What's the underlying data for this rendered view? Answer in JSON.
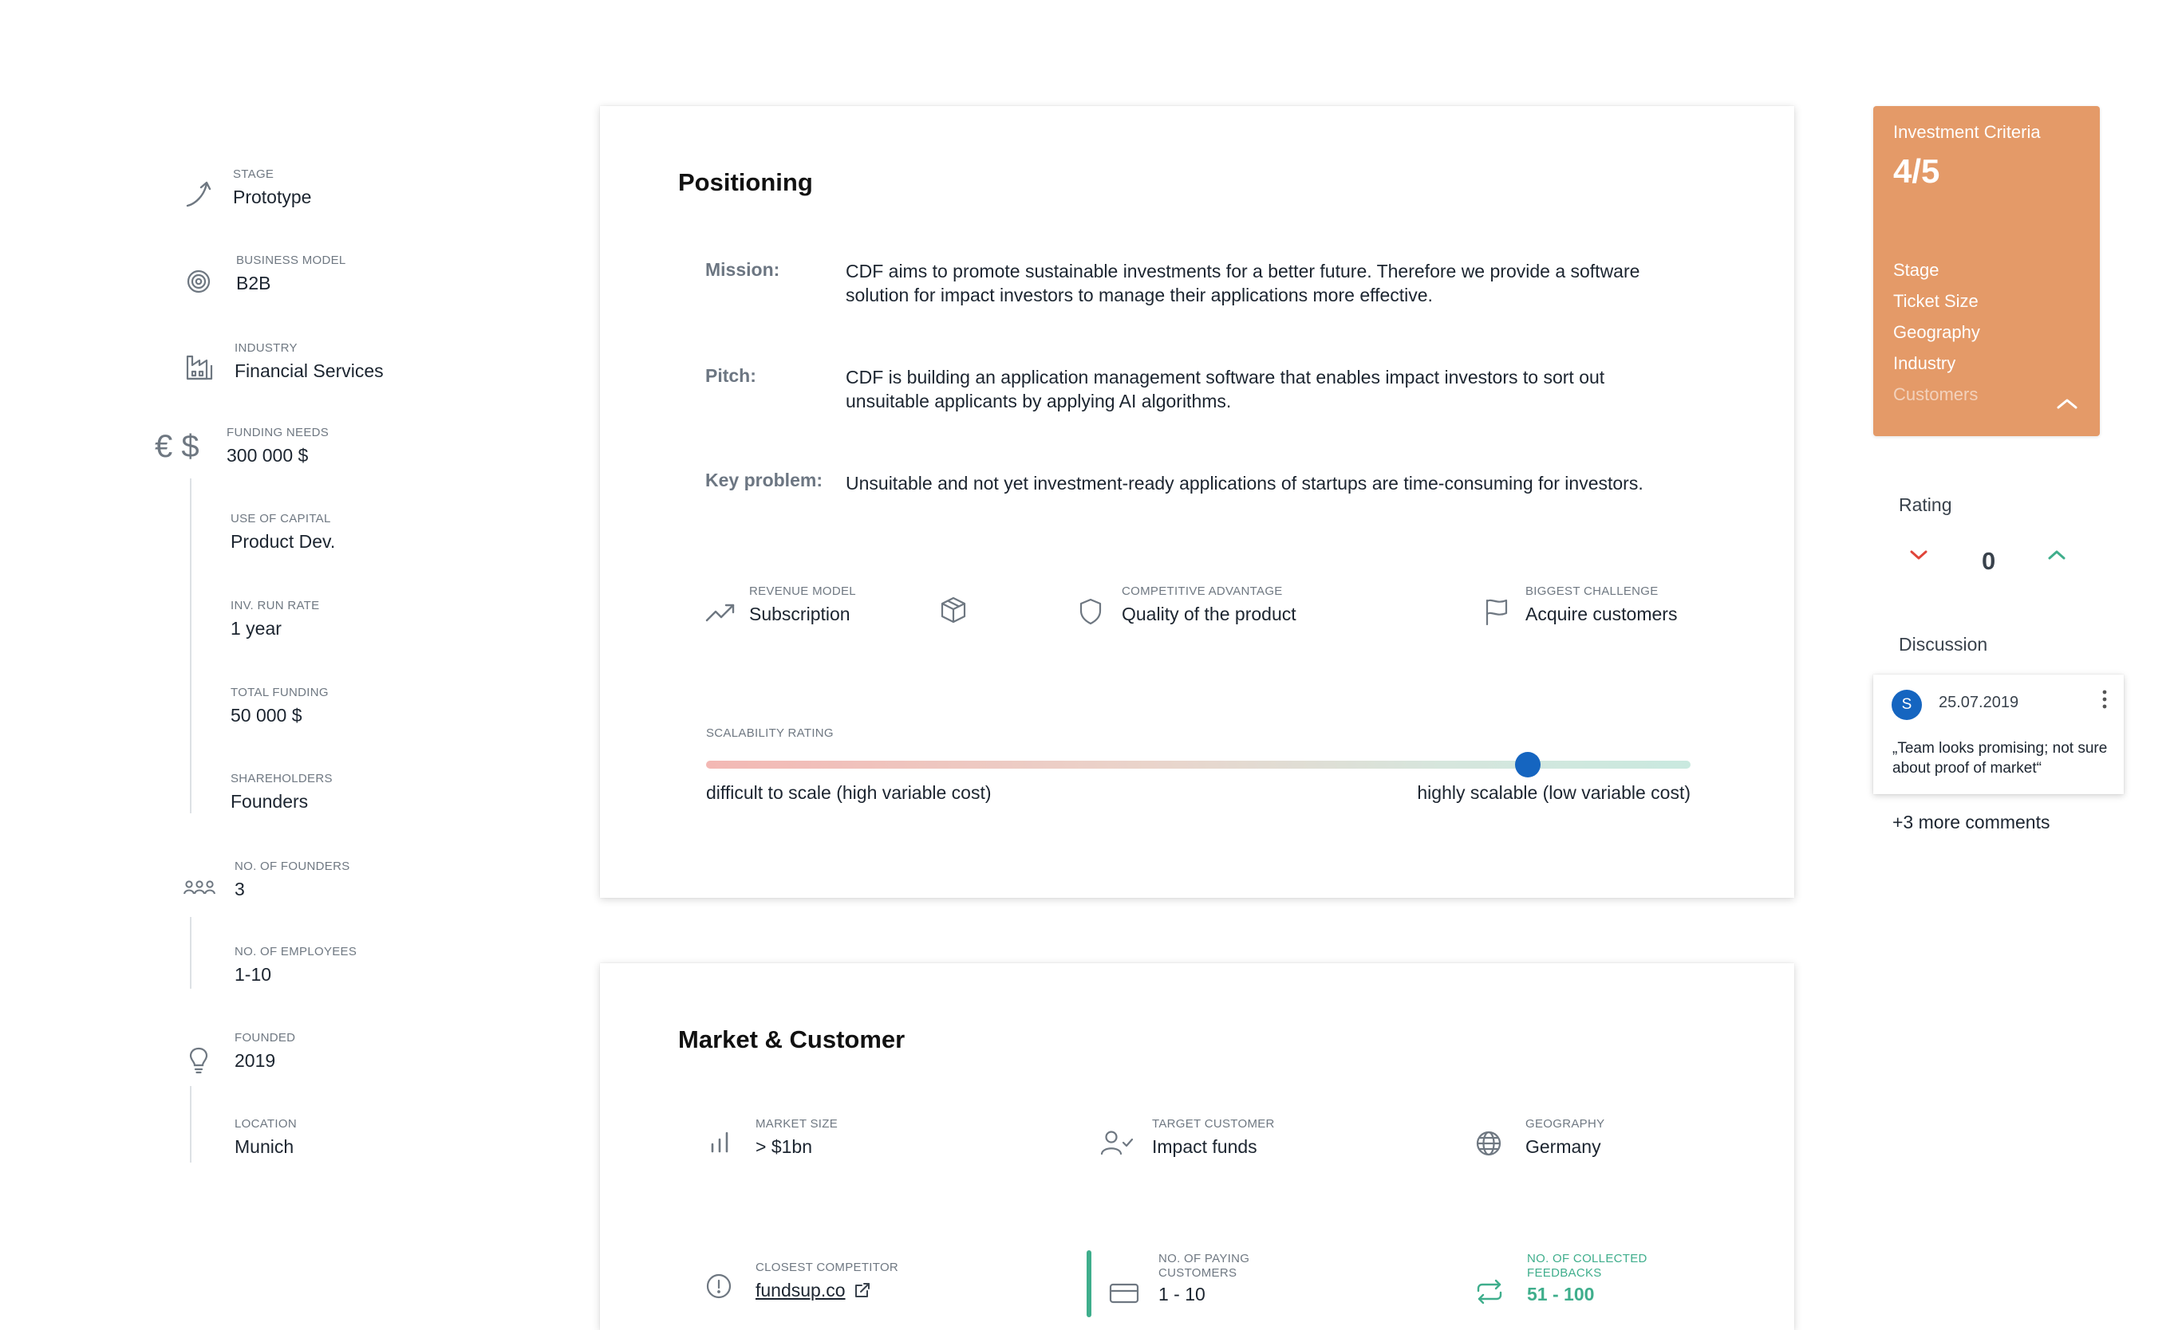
{
  "sidebar": {
    "stage": {
      "label": "STAGE",
      "value": "Prototype"
    },
    "business_model": {
      "label": "BUSINESS MODEL",
      "value": "B2B"
    },
    "industry": {
      "label": "INDUSTRY",
      "value": "Financial Services"
    },
    "currency_symbol": "€ $",
    "funding_needs": {
      "label": "FUNDING NEEDS",
      "value": "300 000 $"
    },
    "use_of_capital": {
      "label": "USE OF CAPITAL",
      "value": "Product Dev."
    },
    "inv_run_rate": {
      "label": "INV. RUN RATE",
      "value": "1 year"
    },
    "total_funding": {
      "label": "TOTAL FUNDING",
      "value": "50 000 $"
    },
    "shareholders": {
      "label": "SHAREHOLDERS",
      "value": "Founders"
    },
    "no_of_founders": {
      "label": "NO. OF FOUNDERS",
      "value": "3"
    },
    "no_of_employees": {
      "label": "NO. OF EMPLOYEES",
      "value": "1-10"
    },
    "founded": {
      "label": "FOUNDED",
      "value": "2019"
    },
    "location": {
      "label": "LOCATION",
      "value": "Munich"
    }
  },
  "positioning": {
    "title": "Positioning",
    "mission": {
      "label": "Mission:",
      "text": "CDF aims to promote sustainable investments for a better future. Therefore we provide a software solution for impact investors to manage their applications more effective."
    },
    "pitch": {
      "label": "Pitch:",
      "text": "CDF is building an application management software that enables impact investors to sort out unsuitable applicants by applying AI algorithms."
    },
    "key_problem": {
      "label": "Key problem:",
      "text": "Unsuitable and not yet investment-ready applications of startups are time-consuming for investors."
    },
    "revenue_model": {
      "label": "REVENUE MODEL",
      "value": "Subscription"
    },
    "competitive_advantage": {
      "label": "COMPETITIVE ADVANTAGE",
      "value": "Quality of the product"
    },
    "biggest_challenge": {
      "label": "BIGGEST CHALLENGE",
      "value": "Acquire customers"
    },
    "scalability": {
      "label": "SCALABILITY RATING",
      "low_label": "difficult to scale (high variable cost)",
      "high_label": "highly scalable (low variable cost)",
      "value_fraction": 0.835
    }
  },
  "market": {
    "title": "Market & Customer",
    "market_size": {
      "label": "MARKET SIZE",
      "value": "> $1bn"
    },
    "target_customer": {
      "label": "TARGET CUSTOMER",
      "value": "Impact funds"
    },
    "geography": {
      "label": "GEOGRAPHY",
      "value": "Germany"
    },
    "closest_competitor": {
      "label": "CLOSEST COMPETITOR",
      "value": "fundsup.co"
    },
    "paying_customers": {
      "label_line1": "NO. OF PAYING",
      "label_line2": "CUSTOMERS",
      "value": "1 - 10"
    },
    "collected_feedbacks": {
      "label_line1": "NO. OF COLLECTED",
      "label_line2": "FEEDBACKS",
      "value": "51 - 100"
    }
  },
  "criteria": {
    "title": "Investment Criteria",
    "score": "4/5",
    "items": [
      "Stage",
      "Ticket Size",
      "Geography",
      "Industry",
      "Customers"
    ]
  },
  "rating": {
    "title": "Rating",
    "value": "0"
  },
  "discussion": {
    "title": "Discussion",
    "avatar_initial": "S",
    "date": "25.07.2019",
    "comment": "„Team looks promising; not sure about proof of market“",
    "more": "+3 more comments"
  },
  "colors": {
    "accent_blue": "#1565c0",
    "criteria_orange": "#e49a68",
    "positive_green": "#3fae8c",
    "negative_red": "#e0453a"
  }
}
